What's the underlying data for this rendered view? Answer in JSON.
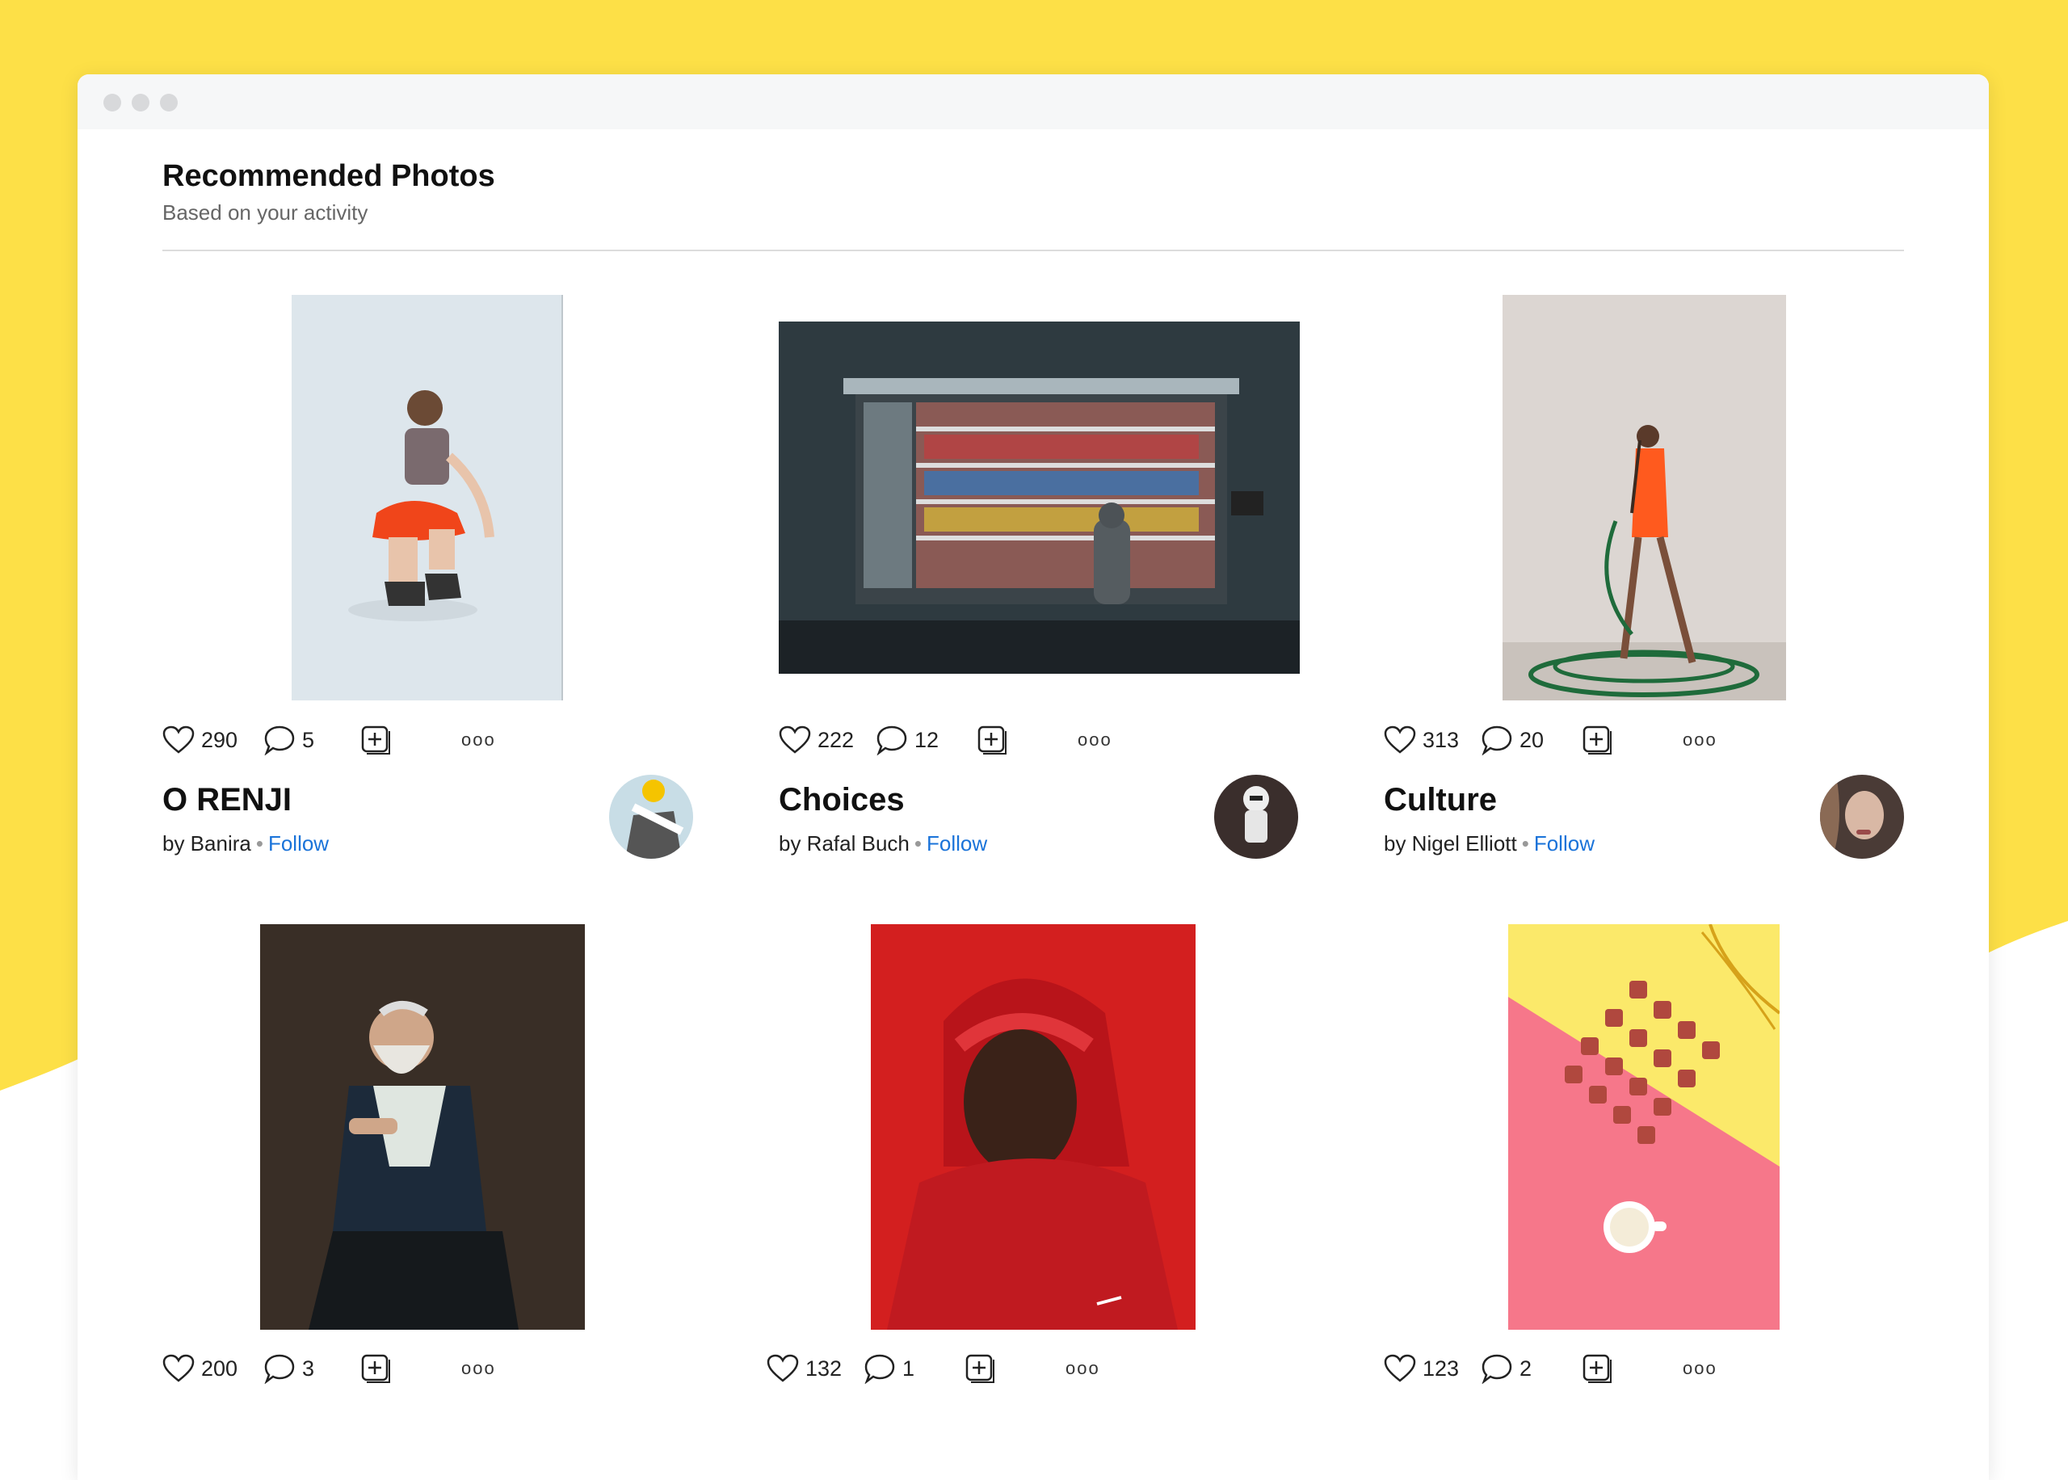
{
  "colors": {
    "yellow": "#FDE047",
    "link": "#1A73D9"
  },
  "header": {
    "title": "Recommended Photos",
    "subtitle": "Based on your activity"
  },
  "posts": [
    {
      "likes": "290",
      "comments": "5",
      "title": "O RENJI",
      "by": "by Banira",
      "follow": "Follow"
    },
    {
      "likes": "222",
      "comments": "12",
      "title": "Choices",
      "by": "by Rafal Buch",
      "follow": "Follow"
    },
    {
      "likes": "313",
      "comments": "20",
      "title": "Culture",
      "by": "by Nigel Elliott",
      "follow": "Follow"
    },
    {
      "likes": "200",
      "comments": "3"
    },
    {
      "likes": "132",
      "comments": "1"
    },
    {
      "likes": "123",
      "comments": "2"
    }
  ],
  "icons": {
    "like": "heart-icon",
    "comment": "comment-bubble-icon",
    "add": "add-to-collection-icon",
    "more": "more-options-icon",
    "more_glyph": "ooo"
  }
}
